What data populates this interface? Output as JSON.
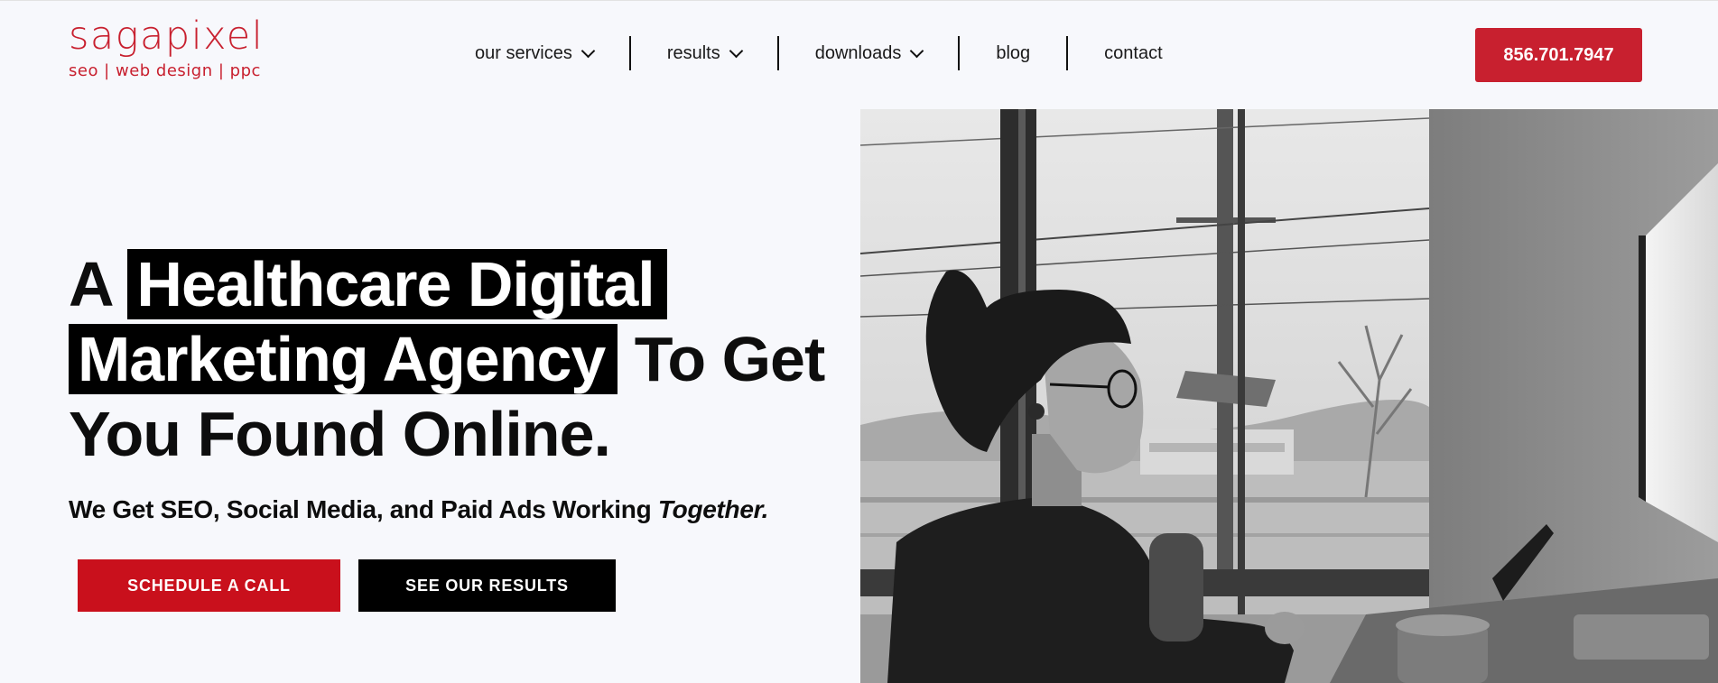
{
  "logo": {
    "name": "sagapixel",
    "tagline": "seo | web design | ppc"
  },
  "nav": {
    "items": [
      {
        "label": "our services",
        "has_dropdown": true
      },
      {
        "label": "results",
        "has_dropdown": true
      },
      {
        "label": "downloads",
        "has_dropdown": true
      },
      {
        "label": "blog",
        "has_dropdown": false
      },
      {
        "label": "contact",
        "has_dropdown": false
      }
    ]
  },
  "header": {
    "phone": "856.701.7947"
  },
  "hero": {
    "title_prefix": "A",
    "title_highlight_1": "Healthcare Digital",
    "title_highlight_2": "Marketing Agency",
    "title_suffix_1": "To Get",
    "title_suffix_2": "You Found Online.",
    "subtitle_main": "We Get SEO, Social Media, and Paid Ads Working",
    "subtitle_emphasis": "Together.",
    "primary_button": "SCHEDULE A CALL",
    "secondary_button": "SEE OUR RESULTS"
  },
  "colors": {
    "brand_red": "#c8202f",
    "button_red": "#c9101c",
    "dark": "#000000",
    "background": "#f7f8fc"
  },
  "icons": {
    "dropdown": "chevron-down-icon"
  }
}
